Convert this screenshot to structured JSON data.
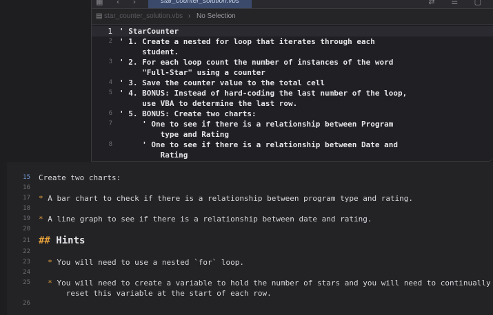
{
  "top_window": {
    "toolbar": {
      "left_icons": "▦ ‹ ›",
      "active_tab": "star_counter_solution.vbs",
      "right_icons": "⇄ ☰ ▢"
    },
    "jumpbar": {
      "doc_icon": "▤",
      "file": "star_counter_solution.vbs",
      "separator": "›",
      "selection": "No Selection"
    },
    "code_lines": [
      {
        "num": "1",
        "text": "' StarCounter"
      },
      {
        "num": "2",
        "text": "' 1. Create a nested for loop that iterates through each"
      },
      {
        "num": "",
        "text": "     student."
      },
      {
        "num": "3",
        "text": "' 2. For each loop count the number of instances of the word"
      },
      {
        "num": "",
        "text": "     \"Full-Star\" using a counter"
      },
      {
        "num": "4",
        "text": "' 3. Save the counter value to the total cell"
      },
      {
        "num": "5",
        "text": "' 4. BONUS: Instead of hard-coding the last number of the loop,"
      },
      {
        "num": "",
        "text": "     use VBA to determine the last row."
      },
      {
        "num": "6",
        "text": "' 5. BONUS: Create two charts:"
      },
      {
        "num": "7",
        "text": "     ' One to see if there is a relationship between Program"
      },
      {
        "num": "",
        "text": "         type and Rating"
      },
      {
        "num": "8",
        "text": "     ' One to see if there is a relationship between Date and"
      },
      {
        "num": "",
        "text": "         Rating"
      }
    ]
  },
  "markdown_editor": {
    "lines": [
      {
        "num": "15",
        "text": "Create two charts:"
      },
      {
        "num": "16",
        "text": ""
      },
      {
        "num": "17",
        "bullet": "* ",
        "text": "A bar chart to check if there is a relationship between program type and rating."
      },
      {
        "num": "18",
        "text": ""
      },
      {
        "num": "19",
        "bullet": "* ",
        "text": "A line graph to see if there is a relationship between date and rating."
      },
      {
        "num": "20",
        "text": ""
      },
      {
        "num": "21",
        "hash": "## ",
        "text": "Hints"
      },
      {
        "num": "22",
        "text": ""
      },
      {
        "num": "23",
        "bullet": "  * ",
        "text": "You will need to use a nested `for` loop."
      },
      {
        "num": "24",
        "text": ""
      },
      {
        "num": "25",
        "bullet": "  * ",
        "text": "You will need to create a variable to hold the number of stars and you will need to continually"
      },
      {
        "num": "",
        "text": "      reset this variable at the start of each row."
      },
      {
        "num": "26",
        "text": ""
      }
    ]
  }
}
